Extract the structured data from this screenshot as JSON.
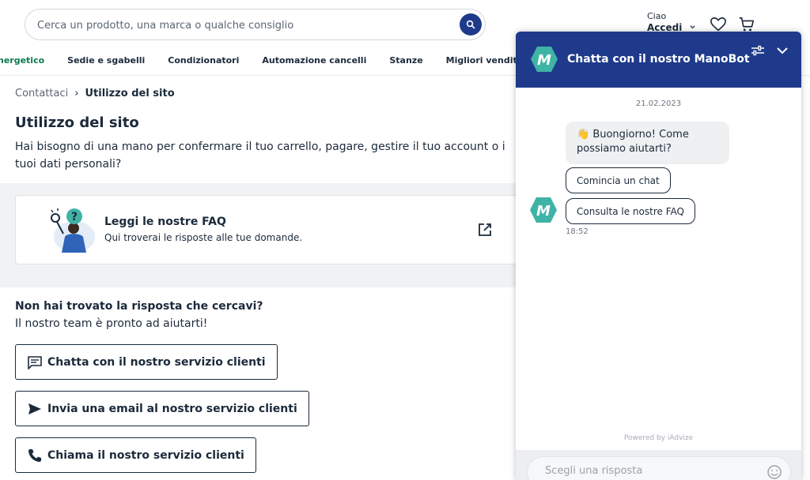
{
  "header": {
    "search_placeholder": "Cerca un prodotto, una marca o qualche consiglio",
    "account_greeting": "Ciao",
    "account_action": "Accedi",
    "nav": [
      "nergetico",
      "Sedie e sgabelli",
      "Condizionatori",
      "Automazione cancelli",
      "Stanze",
      "Migliori vendite"
    ]
  },
  "breadcrumb": {
    "parent": "Contattaci",
    "separator": "›",
    "current": "Utilizzo del sito"
  },
  "page": {
    "title": "Utilizzo del sito",
    "intro": "Hai bisogno di una mano per confermare il tuo carrello, pagare, gestire il tuo account o i tuoi dati personali?"
  },
  "faq": {
    "title": "Leggi le nostre FAQ",
    "subtitle": "Qui troverai le risposte alle tue domande."
  },
  "help": {
    "title": "Non hai trovato la risposta che cercavi?",
    "subtitle": "Il nostro team è pronto ad aiutarti!",
    "buttons": [
      "Chatta con il nostro servizio clienti",
      "Invia una email al nostro servizio clienti",
      "Chiama il nostro servizio clienti"
    ]
  },
  "chat": {
    "title": "Chatta con il nostro ManoBot",
    "logo_letter": "M",
    "date": "21.02.2023",
    "message": "👋 Buongiorno! Come possiamo aiutarti?",
    "quick_replies": [
      "Comincia un chat",
      "Consulta le nostre FAQ"
    ],
    "time": "18:52",
    "powered_by": "Powered by iAdvize",
    "reply_placeholder": "Scegli una risposta"
  },
  "colors": {
    "brand_navy": "#1f3a8a",
    "brand_green": "#0d7a4f",
    "bot_teal": "#3fb3a6"
  }
}
